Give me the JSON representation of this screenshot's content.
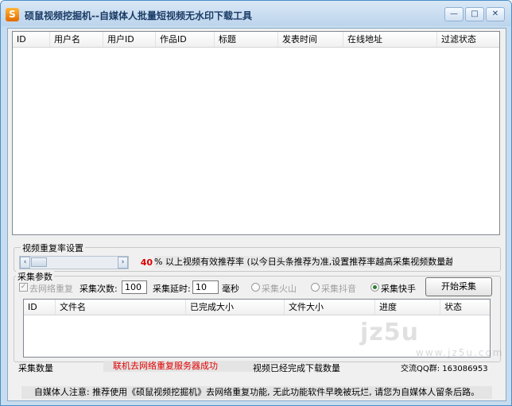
{
  "window": {
    "title": "硕鼠视频挖掘机--自媒体人批量短视频无水印下载工具",
    "app_icon_glyph": "S",
    "controls": {
      "minimize": "—",
      "maximize": "□",
      "close": "✕"
    }
  },
  "main_list": {
    "columns": [
      "ID",
      "用户名",
      "用户ID",
      "作品ID",
      "标题",
      "发表时间",
      "在线地址",
      "过滤状态"
    ]
  },
  "repeat_rate": {
    "group_label": "视频重复率设置",
    "value": "40",
    "description": "% 以上视频有效推荐率 (以今日头条推荐为准,设置推荐率越高采集视频数量越少)"
  },
  "collect": {
    "group_label": "采集参数",
    "dedupe_label": "去网络重复",
    "dedupe_checked": true,
    "count_label": "采集次数:",
    "count_value": "100",
    "delay_label": "采集延时:",
    "delay_value": "10",
    "delay_unit": "毫秒",
    "sources": [
      {
        "label": "采集火山",
        "selected": false,
        "enabled": false
      },
      {
        "label": "采集抖音",
        "selected": false,
        "enabled": false
      },
      {
        "label": "采集快手",
        "selected": true,
        "enabled": true
      }
    ],
    "start_button": "开始采集"
  },
  "files_list": {
    "columns": [
      "ID",
      "文件名",
      "已完成大小",
      "文件大小",
      "进度",
      "状态"
    ]
  },
  "status": {
    "collect_count_label": "采集数量",
    "server_message": "联机去网络重复服务器成功",
    "server_message_color": "#e00000",
    "downloaded_label": "视频已经完成下载数量",
    "qq_group": "交流QQ群: 163086953"
  },
  "notice": "自媒体人注意: 推荐使用《硕鼠视频挖掘机》去网络重复功能, 无此功能软件早晚被玩烂, 请您为自媒体人留条后路。",
  "watermark": {
    "text": "jz5u",
    "url": "www.jz5u.com"
  },
  "icons": {
    "scroll_left": "‹",
    "scroll_right": "›",
    "check": "✓"
  }
}
